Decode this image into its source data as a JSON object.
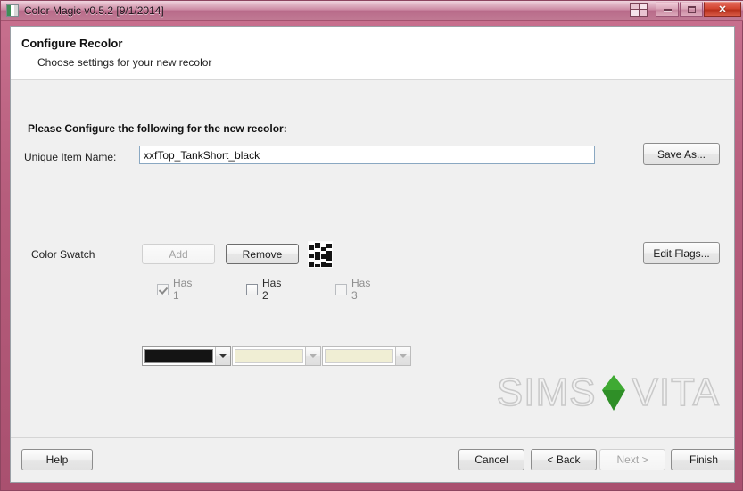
{
  "window": {
    "title": "Color Magic v0.5.2 [9/1/2014]",
    "icon": "app-icon",
    "controls": {
      "aero_snap": "aero-squares-icon",
      "minimize": "minimize-icon",
      "maximize": "maximize-icon",
      "close": "✕"
    },
    "frame_color": "#b65d7c",
    "titlebar_color": "#c77f9b"
  },
  "header": {
    "title": "Configure Recolor",
    "subtitle": "Choose settings for your new recolor"
  },
  "body": {
    "section_title": "Please Configure the following for the new recolor:",
    "unique_name": {
      "label": "Unique Item Name:",
      "value": "xxfTop_TankShort_black",
      "placeholder": ""
    },
    "save_as_label": "Save As...",
    "edit_flags_label": "Edit Flags...",
    "color_swatch": {
      "label": "Color Swatch",
      "add_label": "Add",
      "remove_label": "Remove",
      "thumbnail": "swatch-strips-thumbnail",
      "checkboxes": [
        {
          "label": "Has 1",
          "checked": true,
          "enabled": false
        },
        {
          "label": "Has 2",
          "checked": false,
          "enabled": true
        },
        {
          "label": "Has 3",
          "checked": false,
          "enabled": false
        }
      ],
      "colors": [
        {
          "value": "#141414",
          "enabled": true
        },
        {
          "value": "#f0eed4",
          "enabled": false
        },
        {
          "value": "#f0eed4",
          "enabled": false
        }
      ]
    }
  },
  "watermark": {
    "text_left": "SIMS",
    "text_right": "VITA",
    "plumbob_color": "#3faa33"
  },
  "footer": {
    "help_label": "Help",
    "cancel_label": "Cancel",
    "back_label": "< Back",
    "next_label": "Next >",
    "finish_label": "Finish"
  }
}
